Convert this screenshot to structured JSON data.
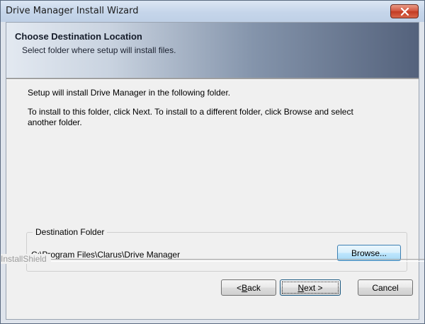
{
  "window": {
    "title": "Drive Manager Install Wizard"
  },
  "header": {
    "title": "Choose Destination Location",
    "subtitle": "Select folder where setup will install files."
  },
  "content": {
    "line1": "Setup will install Drive Manager in the following folder.",
    "line2a": "To install to this folder, click Next. To install to a different folder, click Browse and select",
    "line2b": "another folder."
  },
  "destination": {
    "legend": "Destination Folder",
    "path": "C:\\Program Files\\Clarus\\Drive Manager",
    "browse_label": "Browse..."
  },
  "footer": {
    "brand": "InstallShield",
    "back": {
      "before": "< ",
      "accel": "B",
      "after": "ack"
    },
    "next": {
      "accel": "N",
      "after": "ext >"
    },
    "cancel_label": "Cancel"
  },
  "icons": {
    "close": "close-icon"
  },
  "colors": {
    "close_button": "#c9452d",
    "banner_dark": "#54627c",
    "banner_light": "#e3e9f1"
  }
}
